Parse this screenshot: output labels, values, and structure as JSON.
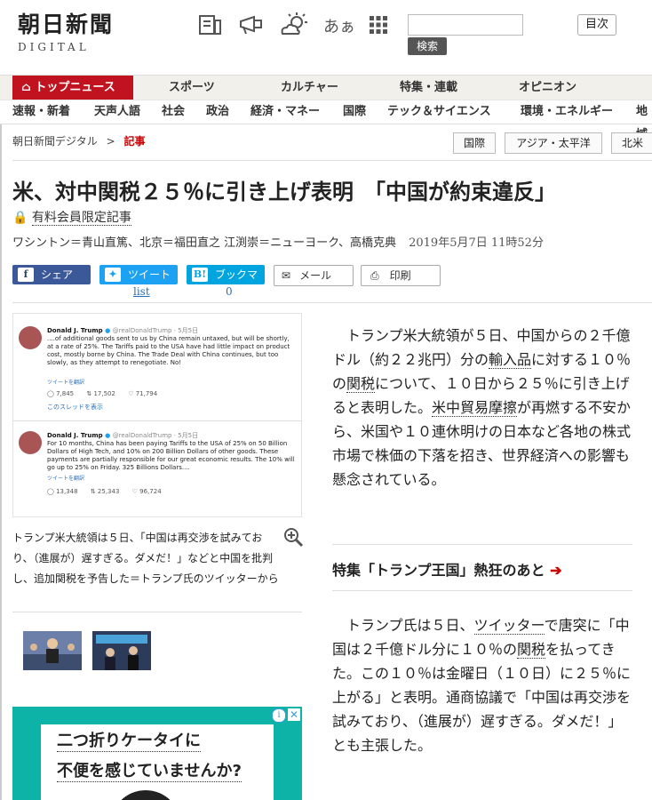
{
  "header": {
    "logo_jp": "朝日新聞",
    "logo_en": "DIGITAL",
    "icons": [
      "newspaper-icon",
      "megaphone-icon",
      "weather-icon",
      "font-size-icon",
      "menu-grid-icon"
    ],
    "font_label": "あぁ",
    "search_button": "検索",
    "mokuji": "目次"
  },
  "nav": {
    "top": "トップニュース",
    "primary": [
      "スポーツ",
      "カルチャー",
      "特集・連載",
      "オピニオン"
    ],
    "secondary": [
      "速報・新着",
      "天声人語",
      "社会",
      "政治",
      "経済・マネー",
      "国際",
      "テック＆サイエンス",
      "環境・エネルギー",
      "地域"
    ]
  },
  "breadcrumb": {
    "home": "朝日新聞デジタル",
    "sep": ">",
    "current": "記事"
  },
  "tags": [
    "国際",
    "アジア・太平洋",
    "北米"
  ],
  "article": {
    "headline": "米、対中関税２５％に引き上げ表明　「中国が約束違反」",
    "members_only": "有料会員限定記事",
    "byline": "ワシントン＝青山直篤、北京＝福田直之 江渕崇＝ニューヨーク、高橋克典",
    "date": "2019年5月7日 11時52分"
  },
  "share": {
    "facebook": "シェア",
    "twitter": "ツイート",
    "twitter_count": "list",
    "hatena": "ブックマーク",
    "hatena_count": "0",
    "mail": "メール",
    "print": "印刷"
  },
  "tweets": [
    {
      "name": "Donald J. Trump",
      "handle": "@realDonaldTrump · 5月5日",
      "body": "....of additional goods sent to us by China remain untaxed, but will be shortly, at a rate of 25%. The Tariffs paid to the USA have had little impact on product cost, mostly borne by China. The Trade Deal with China continues, but too slowly, as they attempt to renegotiate. No!",
      "translate": "ツイートを翻訳",
      "replies": "7,845",
      "retweets": "17,502",
      "likes": "71,794",
      "thread": "このスレッドを表示"
    },
    {
      "name": "Donald J. Trump",
      "handle": "@realDonaldTrump · 5月5日",
      "body": "For 10 months, China has been paying Tariffs to the USA of 25% on 50 Billion Dollars of High Tech, and 10% on 200 Billion Dollars of other goods. These payments are partially responsible for our great economic results. The 10% will go up to 25% on Friday. 325 Billions Dollars....",
      "translate": "ツイートを翻訳",
      "replies": "13,348",
      "retweets": "25,343",
      "likes": "96,724"
    }
  ],
  "caption": "トランプ米大統領は５日、「中国は再交渉を試みており、（進展が）遅すぎる。ダメだ！」などと中国を批判し、追加関税を予告した＝トランプ氏のツイッターから",
  "ad": {
    "line1": "二つ折りケータイに",
    "line2": "不便を感じていませんか?",
    "info": "i",
    "close": "✕"
  },
  "body": {
    "p1": {
      "a": "　トランプ米大統領が５日、中国からの２千億ドル（約２２兆円）分の",
      "k1": "輸入品",
      "b": "に対する１０％の",
      "k2": "関税",
      "c": "について、１０日から２５％に引き上げると表明した。",
      "k3": "米中貿易摩擦",
      "d": "が再燃する不安から、米国や１０連休明けの日本など各地の株式市場で株価の下落を招き、世界経済への影響も懸念されている。"
    },
    "feature": "特集「トランプ王国」熱狂のあと",
    "feature_arrow": "➔",
    "p2": {
      "a": "　トランプ氏は５日、",
      "k1": "ツイッター",
      "b": "で唐突に「中国は２千億ドル分に１０％の",
      "k2": "関税",
      "c": "を払ってきた。この１０％は金曜日（１０日）に２５％に上がる」と表明。通商協議で「中国は再交渉を試みており、（進展が）遅すぎる。ダメだ！」とも主張した。"
    }
  }
}
